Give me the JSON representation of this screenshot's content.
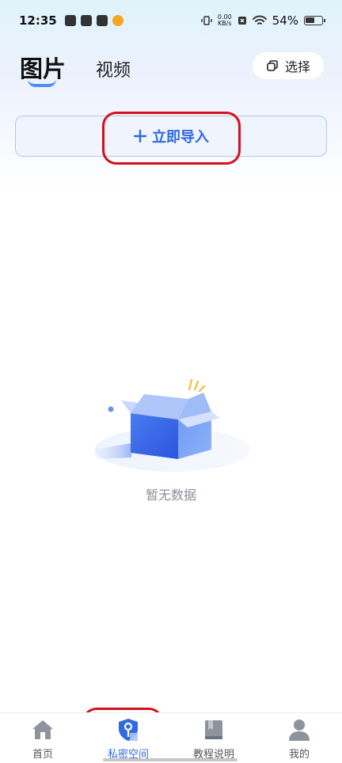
{
  "status_bar": {
    "time": "12:35",
    "speed_value": "0.00",
    "speed_unit": "KB/s",
    "battery": "54%"
  },
  "tabs": [
    {
      "label": "图片",
      "active": true
    },
    {
      "label": "视频",
      "active": false
    }
  ],
  "select_button": {
    "label": "选择",
    "icon": "select-copy-icon"
  },
  "import_button": {
    "label": "立即导入",
    "icon": "plus-icon"
  },
  "empty_state": {
    "label": "暂无数据",
    "icon": "empty-box-icon"
  },
  "bottom_nav": [
    {
      "label": "首页",
      "icon": "home-icon",
      "active": false
    },
    {
      "label": "私密空间",
      "icon": "shield-key-icon",
      "active": true
    },
    {
      "label": "教程说明",
      "icon": "book-icon",
      "active": false
    },
    {
      "label": "我的",
      "icon": "person-icon",
      "active": false
    }
  ],
  "colors": {
    "accent": "#2f6ae0",
    "highlight": "#d3111a"
  }
}
